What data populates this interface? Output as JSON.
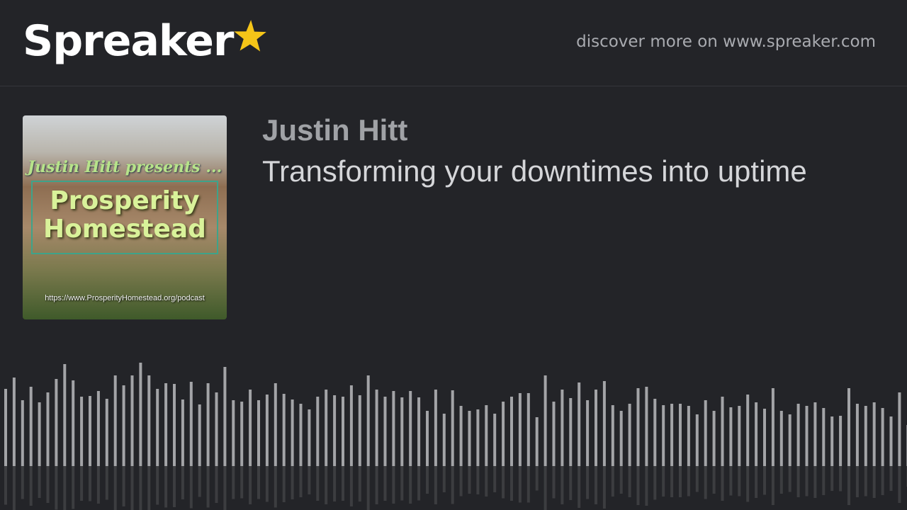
{
  "header": {
    "logo_text": "Spreaker",
    "discover_text": "discover more on www.spreaker.com",
    "accent_color": "#f5c518"
  },
  "cover": {
    "presenter": "Justin Hitt presents ...",
    "line1": "Prosperity",
    "line2": "Homestead",
    "url": "https://www.ProsperityHomestead.org/podcast"
  },
  "episode": {
    "author": "Justin Hitt",
    "title": "Transforming your downtimes into uptime"
  },
  "waveform": {
    "levels": [
      109,
      125,
      93,
      112,
      90,
      104,
      123,
      144,
      121,
      98,
      99,
      106,
      95,
      128,
      114,
      128,
      146,
      128,
      109,
      117,
      116,
      94,
      119,
      87,
      117,
      104,
      140,
      93,
      91,
      108,
      93,
      101,
      117,
      102,
      94,
      88,
      80,
      98,
      108,
      100,
      98,
      114,
      100,
      128,
      108,
      98,
      106,
      97,
      106,
      97,
      78,
      108,
      74,
      107,
      85,
      78,
      80,
      86,
      74,
      91,
      98,
      103,
      103,
      69,
      128,
      91,
      108,
      96,
      118,
      93,
      108,
      120,
      86,
      78,
      88,
      110,
      112,
      95,
      86,
      88,
      88,
      85,
      73,
      93,
      78,
      98,
      83,
      85,
      101,
      90,
      81,
      110,
      78,
      73,
      88,
      85,
      90,
      82,
      70,
      71,
      110,
      88,
      85,
      90,
      82,
      70,
      104,
      58
    ]
  }
}
